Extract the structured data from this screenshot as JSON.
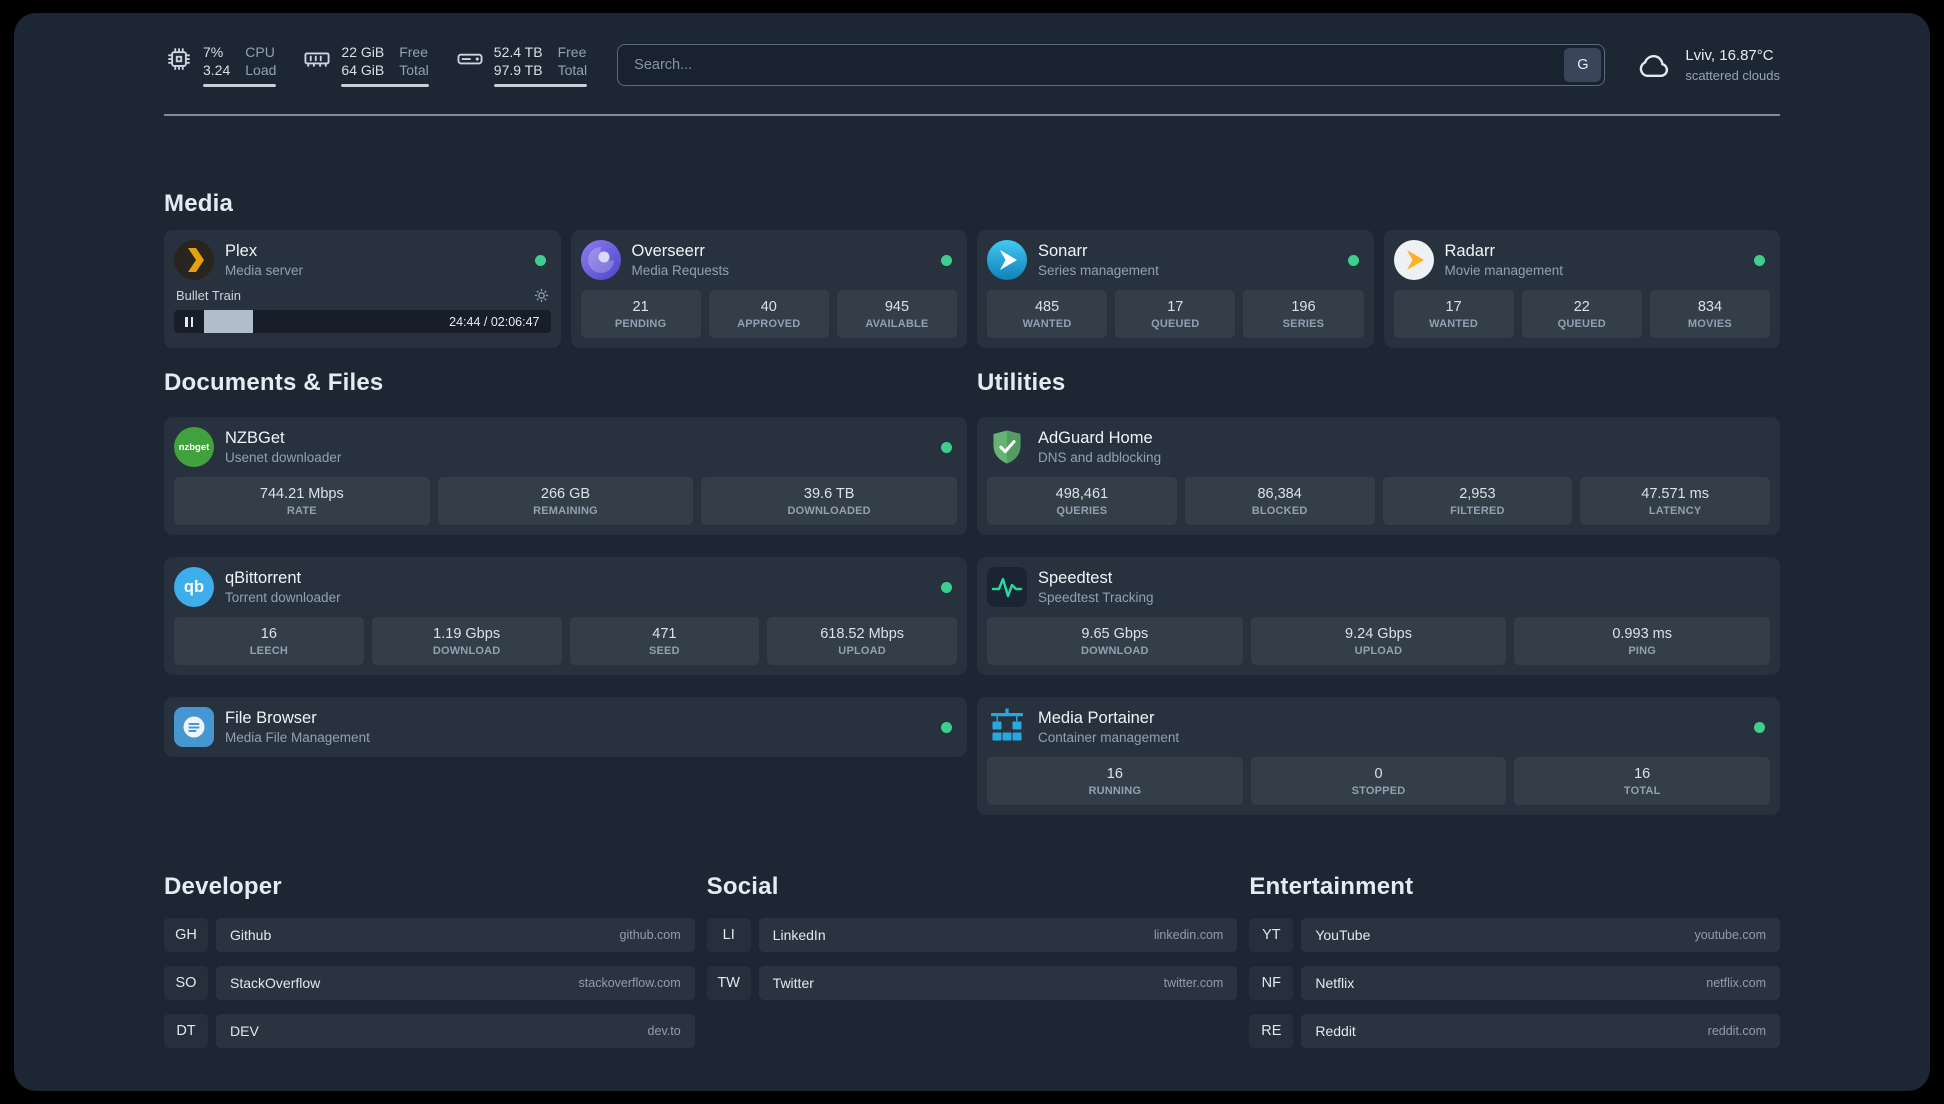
{
  "topbar": {
    "cpu": {
      "icon": "cpu-icon",
      "value_top": "7%",
      "value_bottom": "3.24",
      "label_top": "CPU",
      "label_bottom": "Load"
    },
    "memory": {
      "icon": "memory-icon",
      "value_top": "22 GiB",
      "value_bottom": "64 GiB",
      "label_top": "Free",
      "label_bottom": "Total"
    },
    "disk": {
      "icon": "disk-icon",
      "value_top": "52.4 TB",
      "value_bottom": "97.9 TB",
      "label_top": "Free",
      "label_bottom": "Total"
    },
    "search": {
      "placeholder": "Search...",
      "button_label": "G"
    },
    "weather": {
      "icon": "cloud-icon",
      "location": "Lviv, 16.87°C",
      "condition": "scattered clouds"
    }
  },
  "sections": {
    "media": {
      "title": "Media",
      "plex": {
        "name": "Plex",
        "desc": "Media server",
        "player": {
          "track": "Bullet Train",
          "time": "24:44 / 02:06:47",
          "progress_style": "width:13%"
        }
      },
      "overseerr": {
        "name": "Overseerr",
        "desc": "Media Requests",
        "stats": [
          {
            "value": "21",
            "label": "PENDING"
          },
          {
            "value": "40",
            "label": "APPROVED"
          },
          {
            "value": "945",
            "label": "AVAILABLE"
          }
        ]
      },
      "sonarr": {
        "name": "Sonarr",
        "desc": "Series management",
        "stats": [
          {
            "value": "485",
            "label": "WANTED"
          },
          {
            "value": "17",
            "label": "QUEUED"
          },
          {
            "value": "196",
            "label": "SERIES"
          }
        ]
      },
      "radarr": {
        "name": "Radarr",
        "desc": "Movie management",
        "stats": [
          {
            "value": "17",
            "label": "WANTED"
          },
          {
            "value": "22",
            "label": "QUEUED"
          },
          {
            "value": "834",
            "label": "MOVIES"
          }
        ]
      }
    },
    "documents": {
      "title": "Documents & Files",
      "nzbget": {
        "name": "NZBGet",
        "desc": "Usenet downloader",
        "icon_text": "nzbget",
        "stats": [
          {
            "value": "744.21 Mbps",
            "label": "RATE"
          },
          {
            "value": "266 GB",
            "label": "REMAINING"
          },
          {
            "value": "39.6 TB",
            "label": "DOWNLOADED"
          }
        ]
      },
      "qbittorrent": {
        "name": "qBittorrent",
        "desc": "Torrent downloader",
        "icon_text": "qb",
        "stats": [
          {
            "value": "16",
            "label": "LEECH"
          },
          {
            "value": "1.19 Gbps",
            "label": "DOWNLOAD"
          },
          {
            "value": "471",
            "label": "SEED"
          },
          {
            "value": "618.52 Mbps",
            "label": "UPLOAD"
          }
        ]
      },
      "filebrowser": {
        "name": "File Browser",
        "desc": "Media File Management"
      }
    },
    "utilities": {
      "title": "Utilities",
      "adguard": {
        "name": "AdGuard Home",
        "desc": "DNS and adblocking",
        "stats": [
          {
            "value": "498,461",
            "label": "QUERIES"
          },
          {
            "value": "86,384",
            "label": "BLOCKED"
          },
          {
            "value": "2,953",
            "label": "FILTERED"
          },
          {
            "value": "47.571 ms",
            "label": "LATENCY"
          }
        ]
      },
      "speedtest": {
        "name": "Speedtest",
        "desc": "Speedtest Tracking",
        "stats": [
          {
            "value": "9.65 Gbps",
            "label": "DOWNLOAD"
          },
          {
            "value": "9.24 Gbps",
            "label": "UPLOAD"
          },
          {
            "value": "0.993 ms",
            "label": "PING"
          }
        ]
      },
      "portainer": {
        "name": "Media Portainer",
        "desc": "Container management",
        "stats": [
          {
            "value": "16",
            "label": "RUNNING"
          },
          {
            "value": "0",
            "label": "STOPPED"
          },
          {
            "value": "16",
            "label": "TOTAL"
          }
        ]
      }
    }
  },
  "bookmarks": {
    "developer": {
      "title": "Developer",
      "items": [
        {
          "abbr": "GH",
          "name": "Github",
          "domain": "github.com"
        },
        {
          "abbr": "SO",
          "name": "StackOverflow",
          "domain": "stackoverflow.com"
        },
        {
          "abbr": "DT",
          "name": "DEV",
          "domain": "dev.to"
        }
      ]
    },
    "social": {
      "title": "Social",
      "items": [
        {
          "abbr": "LI",
          "name": "LinkedIn",
          "domain": "linkedin.com"
        },
        {
          "abbr": "TW",
          "name": "Twitter",
          "domain": "twitter.com"
        }
      ]
    },
    "entertainment": {
      "title": "Entertainment",
      "items": [
        {
          "abbr": "YT",
          "name": "YouTube",
          "domain": "youtube.com"
        },
        {
          "abbr": "NF",
          "name": "Netflix",
          "domain": "netflix.com"
        },
        {
          "abbr": "RE",
          "name": "Reddit",
          "domain": "reddit.com"
        }
      ]
    }
  },
  "colors": {
    "status_online": "#3ecf8e",
    "plex_accent": "#e5a00d",
    "background": "#1d2734"
  }
}
